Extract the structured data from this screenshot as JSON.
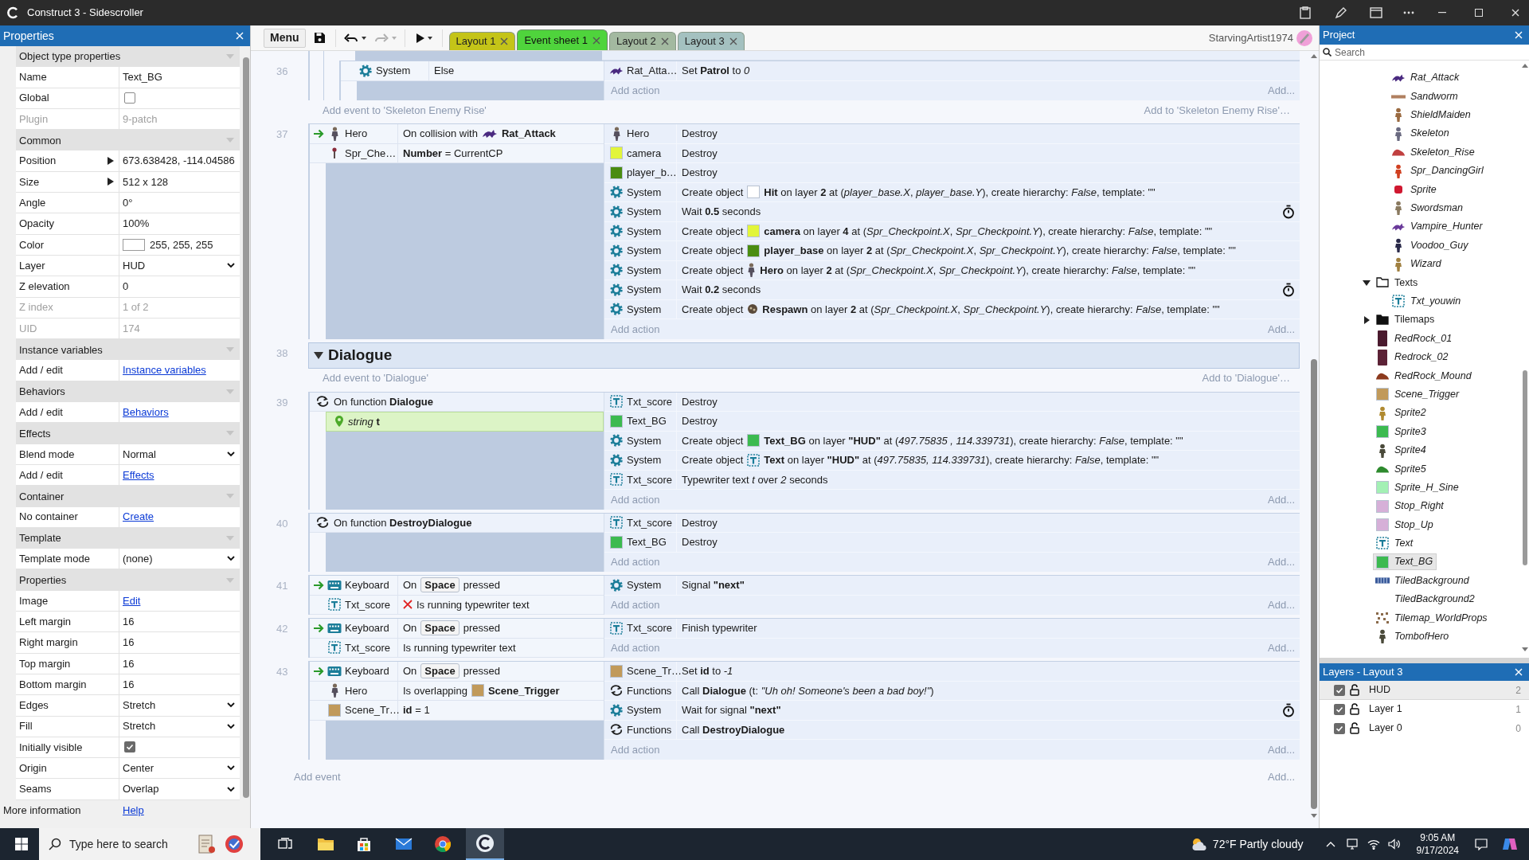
{
  "window": {
    "title": "Construct 3 - Sidescroller"
  },
  "properties": {
    "title": "Properties",
    "rows": [
      {
        "kind": "section",
        "label": "Object type properties"
      },
      {
        "kind": "text",
        "label": "Name",
        "value": "Text_BG"
      },
      {
        "kind": "checkbox",
        "label": "Global",
        "checked": false
      },
      {
        "kind": "readonly",
        "label": "Plugin",
        "value": "9-patch"
      },
      {
        "kind": "section",
        "label": "Common"
      },
      {
        "kind": "expand",
        "label": "Position",
        "value": "673.638428, -114.04586"
      },
      {
        "kind": "expand",
        "label": "Size",
        "value": "512 x 128"
      },
      {
        "kind": "text",
        "label": "Angle",
        "value": "0°"
      },
      {
        "kind": "text",
        "label": "Opacity",
        "value": "100%"
      },
      {
        "kind": "color",
        "label": "Color",
        "value": "255, 255, 255"
      },
      {
        "kind": "dropdown",
        "label": "Layer",
        "value": "HUD"
      },
      {
        "kind": "text",
        "label": "Z elevation",
        "value": "0"
      },
      {
        "kind": "readonly",
        "label": "Z index",
        "value": "1 of 2"
      },
      {
        "kind": "readonly",
        "label": "UID",
        "value": "174"
      },
      {
        "kind": "section",
        "label": "Instance variables"
      },
      {
        "kind": "link",
        "label": "Add / edit",
        "value": "Instance variables"
      },
      {
        "kind": "section",
        "label": "Behaviors"
      },
      {
        "kind": "link",
        "label": "Add / edit",
        "value": "Behaviors"
      },
      {
        "kind": "section",
        "label": "Effects"
      },
      {
        "kind": "dropdown",
        "label": "Blend mode",
        "value": "Normal"
      },
      {
        "kind": "link",
        "label": "Add / edit",
        "value": "Effects"
      },
      {
        "kind": "section",
        "label": "Container"
      },
      {
        "kind": "link",
        "label": "No container",
        "value": "Create"
      },
      {
        "kind": "section",
        "label": "Template"
      },
      {
        "kind": "dropdown",
        "label": "Template mode",
        "value": "(none)"
      },
      {
        "kind": "section",
        "label": "Properties"
      },
      {
        "kind": "link",
        "label": "Image",
        "value": "Edit"
      },
      {
        "kind": "text",
        "label": "Left margin",
        "value": "16"
      },
      {
        "kind": "text",
        "label": "Right margin",
        "value": "16"
      },
      {
        "kind": "text",
        "label": "Top margin",
        "value": "16"
      },
      {
        "kind": "text",
        "label": "Bottom margin",
        "value": "16"
      },
      {
        "kind": "dropdown",
        "label": "Edges",
        "value": "Stretch"
      },
      {
        "kind": "dropdown",
        "label": "Fill",
        "value": "Stretch"
      },
      {
        "kind": "checkbox",
        "label": "Initially visible",
        "checked": true
      },
      {
        "kind": "dropdown",
        "label": "Origin",
        "value": "Center"
      },
      {
        "kind": "dropdown",
        "label": "Seams",
        "value": "Overlap"
      },
      {
        "kind": "footer",
        "label": "More information",
        "value": "Help"
      }
    ]
  },
  "toolbar": {
    "menu": "Menu",
    "undo": {
      "disabled": false
    },
    "redo": {
      "disabled": true
    },
    "tabs": [
      {
        "label": "Layout 1",
        "selected": false,
        "color": "#c4c418"
      },
      {
        "label": "Event sheet 1",
        "selected": true,
        "color": "#4fd43c"
      },
      {
        "label": "Layout 2",
        "selected": false,
        "color": "#a3b9a0"
      },
      {
        "label": "Layout 3",
        "selected": false,
        "color": "#a4c1c0"
      }
    ],
    "user": "StarvingArtist1974"
  },
  "event_sheet": {
    "rows": [
      {
        "kind": "parent",
        "children": [
          {
            "kind": "event",
            "number": "36",
            "trigger": false,
            "add_action": "Add action",
            "add_more": "Add...",
            "conditions": [
              {
                "kind": "object",
                "icon": {
                  "kind": "gear"
                },
                "object": "System",
                "text": "Else",
                "inverted": false
              }
            ],
            "actions": [
              {
                "icon": {
                  "kind": "rat"
                },
                "object": "Rat_Atta…",
                "text": "Set **Patrol** to *0*",
                "timer": false
              }
            ]
          }
        ]
      },
      {
        "kind": "add_event",
        "text": "Add event to 'Skeleton Enemy Rise'",
        "right_text": "Add to 'Skeleton Enemy Rise'…"
      },
      {
        "kind": "event",
        "number": "37",
        "trigger": true,
        "add_action": "Add action",
        "add_more": "Add...",
        "conditions": [
          {
            "kind": "object",
            "icon": {
              "kind": "hero"
            },
            "object": "Hero",
            "text": "On collision with",
            "inline_icon": {
              "kind": "rat"
            },
            "text_after": "**Rat_Attack**",
            "inverted": false
          },
          {
            "kind": "object",
            "icon": {
              "kind": "pin"
            },
            "object": "Spr_Che…",
            "text": "**Number** = CurrentCP",
            "inverted": false
          }
        ],
        "actions": [
          {
            "icon": {
              "kind": "hero"
            },
            "object": "Hero",
            "text": "Destroy",
            "timer": false
          },
          {
            "icon": {
              "kind": "swatch",
              "color": "#e2f53a"
            },
            "object": "camera",
            "text": "Destroy",
            "timer": false
          },
          {
            "icon": {
              "kind": "swatch",
              "color": "#4a8c10"
            },
            "object": "player_b…",
            "text": "Destroy",
            "timer": false
          },
          {
            "icon": {
              "kind": "gear"
            },
            "object": "System",
            "text": "Create object",
            "inline_icon": {
              "kind": "swatch",
              "color": "#ffffff"
            },
            "text_after": "**Hit** on layer **2** at (*player_base.X*, *player_base.Y*), create hierarchy: *False*, template: \"\"",
            "timer": false
          },
          {
            "icon": {
              "kind": "gear"
            },
            "object": "System",
            "text": "Wait **0.5** seconds",
            "timer": true
          },
          {
            "icon": {
              "kind": "gear"
            },
            "object": "System",
            "text": "Create object",
            "inline_icon": {
              "kind": "swatch",
              "color": "#e2f53a"
            },
            "text_after": "**camera** on layer **4** at (*Spr_Checkpoint.X*, *Spr_Checkpoint.Y*), create hierarchy: *False*, template: \"\"",
            "timer": false
          },
          {
            "icon": {
              "kind": "gear"
            },
            "object": "System",
            "text": "Create object",
            "inline_icon": {
              "kind": "swatch",
              "color": "#4a8c10"
            },
            "text_after": "**player_base** on layer **2** at (*Spr_Checkpoint.X*, *Spr_Checkpoint.Y*), create hierarchy: *False*, template: \"\"",
            "timer": false
          },
          {
            "icon": {
              "kind": "gear"
            },
            "object": "System",
            "text": "Create object",
            "inline_icon": {
              "kind": "hero"
            },
            "text_after": "**Hero** on layer **2** at (*Spr_Checkpoint.X*, *Spr_Checkpoint.Y*), create hierarchy: *False*, template: \"\"",
            "timer": false
          },
          {
            "icon": {
              "kind": "gear"
            },
            "object": "System",
            "text": "Wait **0.2** seconds",
            "timer": true
          },
          {
            "icon": {
              "kind": "gear"
            },
            "object": "System",
            "text": "Create object",
            "inline_icon": {
              "kind": "respawn"
            },
            "text_after": "**Respawn** on layer **2** at (*Spr_Checkpoint.X*, *Spr_Checkpoint.Y*), create hierarchy: *False*, template: \"\"",
            "timer": false
          }
        ]
      },
      {
        "kind": "group",
        "number": "38",
        "title": "Dialogue",
        "expanded": true
      },
      {
        "kind": "add_event",
        "text": "Add event to 'Dialogue'",
        "right_text": "Add to 'Dialogue'…"
      },
      {
        "kind": "event",
        "number": "39",
        "trigger": false,
        "add_action": "Add action",
        "add_more": "Add...",
        "conditions": [
          {
            "kind": "function",
            "icon": {
              "kind": "functions"
            },
            "text": "On function **Dialogue**"
          },
          {
            "kind": "param",
            "icon": {
              "kind": "location"
            },
            "text": "*string* **t**"
          }
        ],
        "actions": [
          {
            "icon": {
              "kind": "text"
            },
            "object": "Txt_score",
            "text": "Destroy",
            "timer": false
          },
          {
            "icon": {
              "kind": "swatch",
              "color": "#3cba50"
            },
            "object": "Text_BG",
            "text": "Destroy",
            "timer": false
          },
          {
            "icon": {
              "kind": "gear"
            },
            "object": "System",
            "text": "Create object",
            "inline_icon": {
              "kind": "swatch",
              "color": "#3cba50"
            },
            "text_after": "**Text_BG** on layer **\"HUD\"** at (*497.75835 , 114.339731*), create hierarchy: *False*, template: \"\"",
            "timer": false
          },
          {
            "icon": {
              "kind": "gear"
            },
            "object": "System",
            "text": "Create object",
            "inline_icon": {
              "kind": "text"
            },
            "text_after": "**Text** on layer **\"HUD\"** at (*497.75835, 114.339731*), create hierarchy: *False*, template: \"\"",
            "timer": false
          },
          {
            "icon": {
              "kind": "text"
            },
            "object": "Txt_score",
            "text": "Typewriter text *t* over *2* seconds",
            "timer": false
          }
        ]
      },
      {
        "kind": "event",
        "number": "40",
        "trigger": false,
        "add_action": "Add action",
        "add_more": "Add...",
        "conditions": [
          {
            "kind": "function",
            "icon": {
              "kind": "functions"
            },
            "text": "On function **DestroyDialogue**"
          }
        ],
        "actions": [
          {
            "icon": {
              "kind": "text"
            },
            "object": "Txt_score",
            "text": "Destroy",
            "timer": false
          },
          {
            "icon": {
              "kind": "swatch",
              "color": "#3cba50"
            },
            "object": "Text_BG",
            "text": "Destroy",
            "timer": false
          }
        ]
      },
      {
        "kind": "event",
        "number": "41",
        "trigger": true,
        "add_action": "Add action",
        "add_more": "Add...",
        "conditions": [
          {
            "kind": "object",
            "icon": {
              "kind": "keyboard"
            },
            "object": "Keyboard",
            "text": "On",
            "key": "Space",
            "text_after": "pressed",
            "inverted": false
          },
          {
            "kind": "object",
            "icon": {
              "kind": "text"
            },
            "object": "Txt_score",
            "text": "Is running typewriter text",
            "inverted": true
          }
        ],
        "actions": [
          {
            "icon": {
              "kind": "gear"
            },
            "object": "System",
            "text": "Signal **\"next\"**",
            "timer": false
          }
        ]
      },
      {
        "kind": "event",
        "number": "42",
        "trigger": true,
        "add_action": "Add action",
        "add_more": "Add...",
        "conditions": [
          {
            "kind": "object",
            "icon": {
              "kind": "keyboard"
            },
            "object": "Keyboard",
            "text": "On",
            "key": "Space",
            "text_after": "pressed",
            "inverted": false
          },
          {
            "kind": "object",
            "icon": {
              "kind": "text"
            },
            "object": "Txt_score",
            "text": "Is running typewriter text",
            "inverted": false
          }
        ],
        "actions": [
          {
            "icon": {
              "kind": "text"
            },
            "object": "Txt_score",
            "text": "Finish typewriter",
            "timer": false
          }
        ]
      },
      {
        "kind": "event",
        "number": "43",
        "trigger": true,
        "add_action": "Add action",
        "add_more": "Add...",
        "conditions": [
          {
            "kind": "object",
            "icon": {
              "kind": "keyboard"
            },
            "object": "Keyboard",
            "text": "On",
            "key": "Space",
            "text_after": "pressed",
            "inverted": false
          },
          {
            "kind": "object",
            "icon": {
              "kind": "hero"
            },
            "object": "Hero",
            "text": "Is overlapping",
            "inline_icon": {
              "kind": "swatch",
              "color": "#c19a5b"
            },
            "text_after": "**Scene_Trigger**",
            "inverted": false
          },
          {
            "kind": "object",
            "icon": {
              "kind": "swatch",
              "color": "#c19a5b"
            },
            "object": "Scene_Tr…",
            "text": "**id** = 1",
            "inverted": false
          }
        ],
        "actions": [
          {
            "icon": {
              "kind": "swatch",
              "color": "#c19a5b"
            },
            "object": "Scene_Tr…",
            "text": "Set **id** to *-1*",
            "timer": false
          },
          {
            "icon": {
              "kind": "functions"
            },
            "object": "Functions",
            "text": "Call **Dialogue** (t: *\"Uh oh! Someone's been a bad boy!\"*)",
            "timer": false
          },
          {
            "icon": {
              "kind": "gear"
            },
            "object": "System",
            "text": "Wait for signal **\"next\"**",
            "timer": true
          },
          {
            "icon": {
              "kind": "functions"
            },
            "object": "Functions",
            "text": "Call **DestroyDialogue**",
            "timer": false
          }
        ]
      },
      {
        "kind": "add_event_end",
        "text": "Add event",
        "right_text": "Add..."
      }
    ]
  },
  "project": {
    "title": "Project",
    "search_placeholder": "Search",
    "tree": [
      {
        "kind": "offscreen_folder",
        "children": [
          {
            "kind": "object",
            "label": "Rat_Attack",
            "selected": false,
            "icon": {
              "kind": "creature",
              "color": "#4a2a80"
            }
          },
          {
            "kind": "object",
            "label": "Sandworm",
            "selected": false,
            "icon": {
              "kind": "line",
              "color": "#b08060"
            }
          },
          {
            "kind": "object",
            "label": "ShieldMaiden",
            "selected": false,
            "icon": {
              "kind": "figure",
              "color": "#9a6a40"
            }
          },
          {
            "kind": "object",
            "label": "Skeleton",
            "selected": false,
            "icon": {
              "kind": "figure",
              "color": "#6a6a80"
            }
          },
          {
            "kind": "object",
            "label": "Skeleton_Rise",
            "selected": false,
            "icon": {
              "kind": "mound",
              "color": "#c04040"
            }
          },
          {
            "kind": "object",
            "label": "Spr_DancingGirl",
            "selected": false,
            "icon": {
              "kind": "figure",
              "color": "#d04020"
            }
          },
          {
            "kind": "object",
            "label": "Sprite",
            "selected": false,
            "icon": {
              "kind": "blob",
              "color": "#d01830"
            }
          },
          {
            "kind": "object",
            "label": "Swordsman",
            "selected": false,
            "icon": {
              "kind": "figure",
              "color": "#8a7a60"
            }
          },
          {
            "kind": "object",
            "label": "Vampire_Hunter",
            "selected": false,
            "icon": {
              "kind": "creature",
              "color": "#6a3a9a"
            }
          },
          {
            "kind": "object",
            "label": "Voodoo_Guy",
            "selected": false,
            "icon": {
              "kind": "figure",
              "color": "#2a2a4a"
            }
          },
          {
            "kind": "object",
            "label": "Wizard",
            "selected": false,
            "icon": {
              "kind": "figure",
              "color": "#a08040"
            }
          }
        ]
      },
      {
        "kind": "folder",
        "label": "Texts",
        "expanded": true,
        "selected": false,
        "children": [
          {
            "kind": "object",
            "label": "Txt_youwin",
            "selected": false,
            "icon": {
              "kind": "text"
            }
          }
        ]
      },
      {
        "kind": "folder",
        "label": "Tilemaps",
        "expanded": false,
        "selected": false
      },
      {
        "kind": "object",
        "label": "RedRock_01",
        "selected": false,
        "icon": {
          "kind": "rock",
          "color": "#4a1a2e"
        }
      },
      {
        "kind": "object",
        "label": "Redrock_02",
        "selected": false,
        "icon": {
          "kind": "rock",
          "color": "#5c2236"
        }
      },
      {
        "kind": "object",
        "label": "RedRock_Mound",
        "selected": false,
        "icon": {
          "kind": "mound",
          "color": "#8c3a1e"
        }
      },
      {
        "kind": "object",
        "label": "Scene_Trigger",
        "selected": false,
        "icon": {
          "kind": "swatch",
          "color": "#c19a5b"
        }
      },
      {
        "kind": "object",
        "label": "Sprite2",
        "selected": false,
        "icon": {
          "kind": "figure",
          "color": "#b08a30"
        }
      },
      {
        "kind": "object",
        "label": "Sprite3",
        "selected": false,
        "icon": {
          "kind": "swatch",
          "color": "#3cba50"
        }
      },
      {
        "kind": "object",
        "label": "Sprite4",
        "selected": false,
        "icon": {
          "kind": "figure",
          "color": "#4a4a3a"
        }
      },
      {
        "kind": "object",
        "label": "Sprite5",
        "selected": false,
        "icon": {
          "kind": "mound",
          "color": "#2e8a2e"
        }
      },
      {
        "kind": "object",
        "label": "Sprite_H_Sine",
        "selected": false,
        "icon": {
          "kind": "swatch",
          "color": "#a3f0b4"
        }
      },
      {
        "kind": "object",
        "label": "Stop_Right",
        "selected": false,
        "icon": {
          "kind": "swatch",
          "color": "#d6b0d8"
        }
      },
      {
        "kind": "object",
        "label": "Stop_Up",
        "selected": false,
        "icon": {
          "kind": "swatch",
          "color": "#d6b0d8"
        }
      },
      {
        "kind": "object",
        "label": "Text",
        "selected": false,
        "icon": {
          "kind": "text"
        }
      },
      {
        "kind": "object",
        "label": "Text_BG",
        "selected": true,
        "icon": {
          "kind": "swatch",
          "color": "#3cba50"
        }
      },
      {
        "kind": "object",
        "label": "TiledBackground",
        "selected": false,
        "icon": {
          "kind": "tiles",
          "color": "#3a5a9a"
        }
      },
      {
        "kind": "object",
        "label": "TiledBackground2",
        "selected": false
      },
      {
        "kind": "object",
        "label": "Tilemap_WorldProps",
        "selected": false,
        "icon": {
          "kind": "dots",
          "color": "#8a6a4a"
        }
      },
      {
        "kind": "object",
        "label": "TombofHero",
        "selected": false,
        "icon": {
          "kind": "figure",
          "color": "#4a4a3a"
        }
      }
    ]
  },
  "layers": {
    "title": "Layers - Layout 3",
    "items": [
      {
        "name": "HUD",
        "count": "2",
        "visible": true,
        "locked": false,
        "selected": true
      },
      {
        "name": "Layer 1",
        "count": "1",
        "visible": true,
        "locked": false,
        "selected": false
      },
      {
        "name": "Layer 0",
        "count": "0",
        "visible": true,
        "locked": false,
        "selected": false
      }
    ]
  },
  "taskbar": {
    "search_placeholder": "Type here to search",
    "weather": "72°F Partly cloudy",
    "time": "9:05 AM",
    "date": "9/17/2024"
  }
}
